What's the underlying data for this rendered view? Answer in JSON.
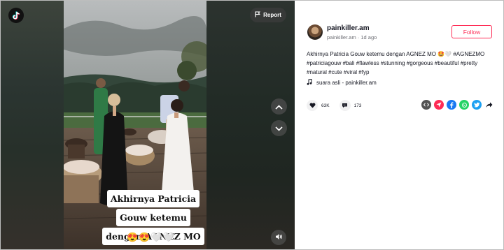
{
  "player": {
    "report_label": "Report",
    "caption_lines": [
      "Akhirnya Patricia",
      "Gouw ketemu",
      "dengan AGNEZ MO"
    ],
    "caption_emojis": "😍😍🤍🤍",
    "icons": {
      "logo": "tiktok-logo-icon",
      "report": "flag-icon",
      "prev": "chevron-up-icon",
      "next": "chevron-down-icon",
      "sound": "volume-icon"
    }
  },
  "author": {
    "username": "painkiller.am",
    "handle": "painkiller.am",
    "separator": " · ",
    "time_ago": "1d ago",
    "follow_label": "Follow"
  },
  "post": {
    "description": "Akhirnya Patricia Gouw ketemu dengan AGNEZ MO 🤩🤍 #AGNEZMO #patriciagouw #bali #flawless #stunning #gorgeous #beautiful #pretty #natural #cute #viral #fyp",
    "music": "suara asli - painkiller.am"
  },
  "stats": {
    "likes": "63K",
    "comments": "173"
  },
  "share": {
    "items": [
      "embed",
      "send",
      "facebook",
      "whatsapp",
      "twitter",
      "more"
    ],
    "colors": {
      "embed": "#545454",
      "send": "#fe2c55",
      "facebook": "#1877f2",
      "whatsapp": "#25d366",
      "twitter": "#1da1f2"
    }
  },
  "colors": {
    "accent": "#fe2c55",
    "text": "#161823",
    "muted": "#6f7076"
  }
}
